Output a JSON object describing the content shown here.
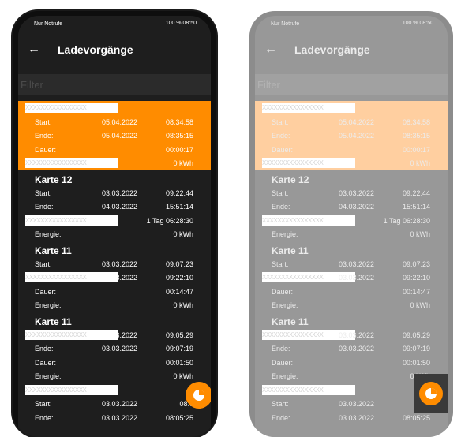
{
  "status": {
    "carrier": "Nur Notrufe",
    "right": "100 %  08:50"
  },
  "appbar": {
    "back_icon": "arrow-left-icon",
    "title": "Ladevorgänge"
  },
  "filter": {
    "placeholder": "Filter"
  },
  "mask_text": "XXXXXXXXXXXXXXXX",
  "entries": [
    {
      "selected": true,
      "title": "",
      "rows": [
        {
          "label": "Start:",
          "date": "05.04.2022",
          "time": "08:34:58"
        },
        {
          "label": "Ende:",
          "date": "05.04.2022",
          "time": "08:35:15"
        },
        {
          "label": "Dauer:",
          "value": "00:00:17"
        },
        {
          "label": "",
          "value": "0 kWh"
        }
      ]
    },
    {
      "selected": false,
      "title": "Karte 12",
      "rows": [
        {
          "label": "Start:",
          "date": "03.03.2022",
          "time": "09:22:44"
        },
        {
          "label": "Ende:",
          "date": "04.03.2022",
          "time": "15:51:14"
        },
        {
          "label": "",
          "value": "1 Tag 06:28:30"
        },
        {
          "label": "Energie:",
          "value": "0 kWh"
        }
      ]
    },
    {
      "selected": false,
      "title": "Karte 11",
      "rows": [
        {
          "label": "Start:",
          "date": "03.03.2022",
          "time": "09:07:23"
        },
        {
          "label": "",
          "date": "03.03.2022",
          "time": "09:22:10"
        },
        {
          "label": "Dauer:",
          "value": "00:14:47"
        },
        {
          "label": "Energie:",
          "value": "0 kWh"
        }
      ]
    },
    {
      "selected": false,
      "title": "Karte 11",
      "rows": [
        {
          "label": "",
          "date": "03.03.2022",
          "time": "09:05:29"
        },
        {
          "label": "Ende:",
          "date": "03.03.2022",
          "time": "09:07:19"
        },
        {
          "label": "Dauer:",
          "value": "00:01:50"
        },
        {
          "label": "Energie:",
          "value": "0 kWh"
        }
      ]
    },
    {
      "selected": false,
      "title": "",
      "rows": [
        {
          "label": "Start:",
          "date": "03.03.2022",
          "time": "08:0"
        },
        {
          "label": "Ende:",
          "date": "03.03.2022",
          "time": "08:05:25"
        }
      ]
    }
  ],
  "fab": {
    "icon": "pie-chart-icon",
    "color": "#ff8c00"
  },
  "colors": {
    "accent": "#ff8c00",
    "background_dark": "#1e1e1e",
    "selected_faded": "#ffcfa0"
  }
}
